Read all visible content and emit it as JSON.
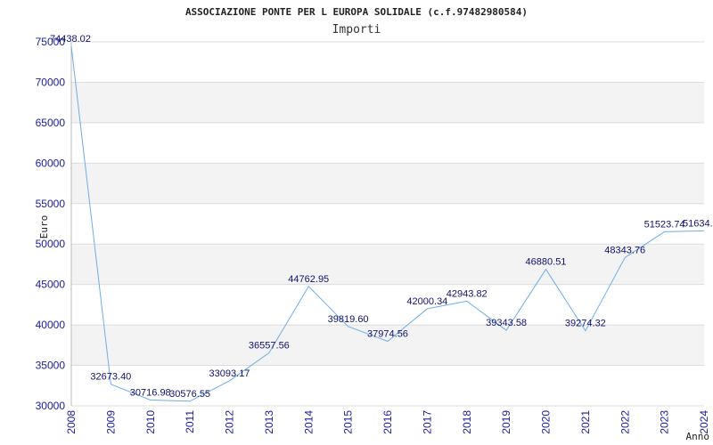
{
  "chart_data": {
    "type": "line",
    "title": "ASSOCIAZIONE PONTE PER L EUROPA SOLIDALE (c.f.97482980584)",
    "subtitle": "Importi",
    "xlabel": "Anno",
    "ylabel": "Euro",
    "ylim": [
      30000,
      75000
    ],
    "yticks": [
      "30000",
      "35000",
      "40000",
      "45000",
      "50000",
      "55000",
      "60000",
      "65000",
      "70000",
      "75000"
    ],
    "categories": [
      "2008",
      "2009",
      "2010",
      "2011",
      "2012",
      "2013",
      "2014",
      "2015",
      "2016",
      "2017",
      "2018",
      "2019",
      "2020",
      "2021",
      "2022",
      "2023",
      "2024"
    ],
    "values": [
      74438.02,
      32673.4,
      30716.98,
      30576.55,
      33093.17,
      36557.56,
      44762.95,
      39819.6,
      37974.56,
      42000.34,
      42943.82,
      39343.58,
      46880.51,
      39274.32,
      48343.76,
      51523.74,
      51634.0
    ],
    "data_labels": [
      "74438.02",
      "32673.40",
      "30716.98",
      "30576.55",
      "33093.17",
      "36557.56",
      "44762.95",
      "39819.60",
      "37974.56",
      "42000.34",
      "42943.82",
      "39343.58",
      "46880.51",
      "39274.32",
      "48343.76",
      "51523.74",
      "51634."
    ],
    "grid": true,
    "banded_background": true,
    "colors": {
      "line": "#6aaee8",
      "band": "#f3f3f3",
      "grid": "#dcdcdc",
      "tick_text": "#1a1aa6",
      "label_text": "#101070"
    }
  }
}
